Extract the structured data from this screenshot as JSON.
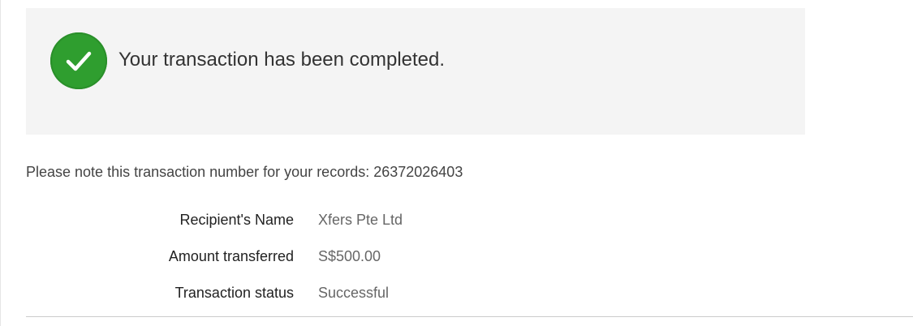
{
  "banner": {
    "icon": "check-circle-icon",
    "message": "Your transaction has been completed.",
    "accent_color": "#2f9e2f"
  },
  "note": {
    "text": "Please note this transaction number for your records: 26372026403"
  },
  "details": {
    "rows": [
      {
        "label": "Recipient's Name",
        "value": "Xfers Pte Ltd"
      },
      {
        "label": "Amount transferred",
        "value": "S$500.00"
      },
      {
        "label": "Transaction status",
        "value": "Successful"
      }
    ]
  }
}
